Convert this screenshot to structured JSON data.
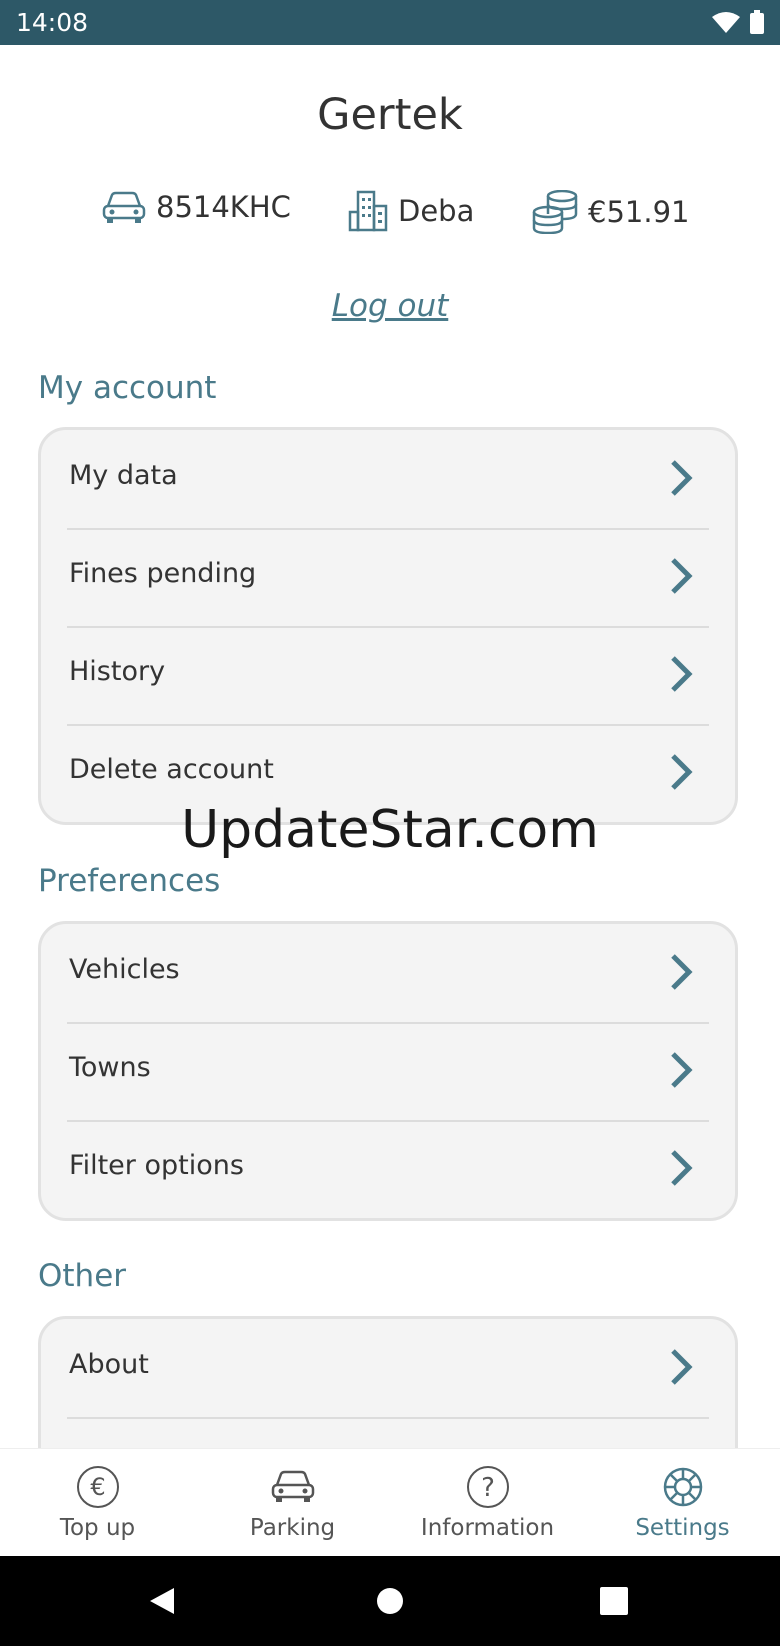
{
  "status_bar": {
    "time": "14:08",
    "bg": "#2d5867"
  },
  "user": {
    "name": "Gertek"
  },
  "info": {
    "plate": "8514KHC",
    "town": "Deba",
    "balance": "€51.91",
    "icons": [
      "car-icon",
      "buildings-icon",
      "coins-icon"
    ]
  },
  "logout_label": "Log out",
  "sections": {
    "my_account": {
      "title": "My account",
      "items": [
        "My data",
        "Fines pending",
        "History",
        "Delete account"
      ]
    },
    "preferences": {
      "title": "Preferences",
      "items": [
        "Vehicles",
        "Towns",
        "Filter options"
      ]
    },
    "other": {
      "title": "Other",
      "items": [
        "About"
      ]
    }
  },
  "watermark": "UpdateStar.com",
  "tabs": {
    "items": [
      {
        "label": "Top up",
        "icon": "euro-icon"
      },
      {
        "label": "Parking",
        "icon": "car-icon"
      },
      {
        "label": "Information",
        "icon": "question-icon"
      },
      {
        "label": "Settings",
        "icon": "settings-wheel-icon"
      }
    ],
    "active": "Settings"
  },
  "colors": {
    "accent": "#4a7a8a",
    "text": "#333333",
    "card_bg": "#f4f4f4"
  }
}
